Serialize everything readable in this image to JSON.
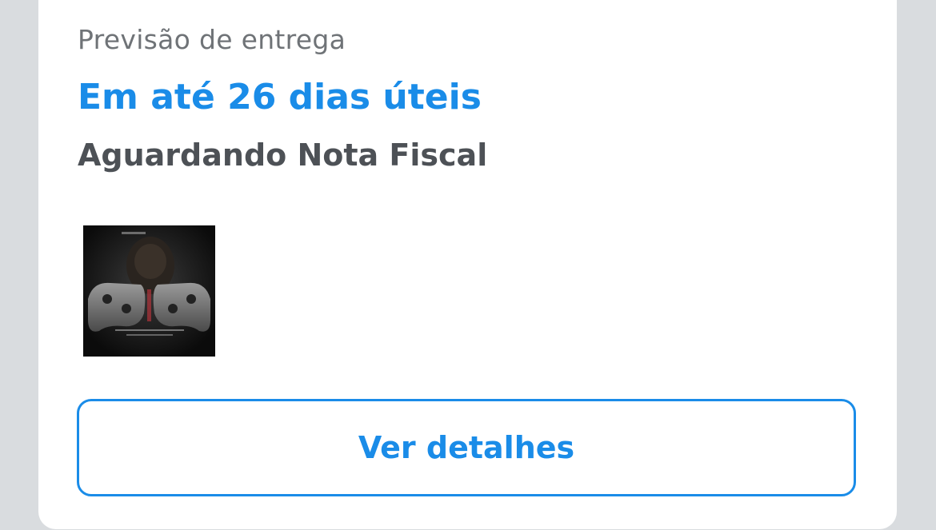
{
  "order": {
    "delivery_label": "Previsão de entrega",
    "delivery_estimate": "Em até 26 dias úteis",
    "status_text": "Aguardando Nota Fiscal",
    "details_button_label": "Ver detalhes"
  },
  "product": {
    "thumbnail_icon": "controller-product-image",
    "accent_color": "#1a8ce8"
  }
}
